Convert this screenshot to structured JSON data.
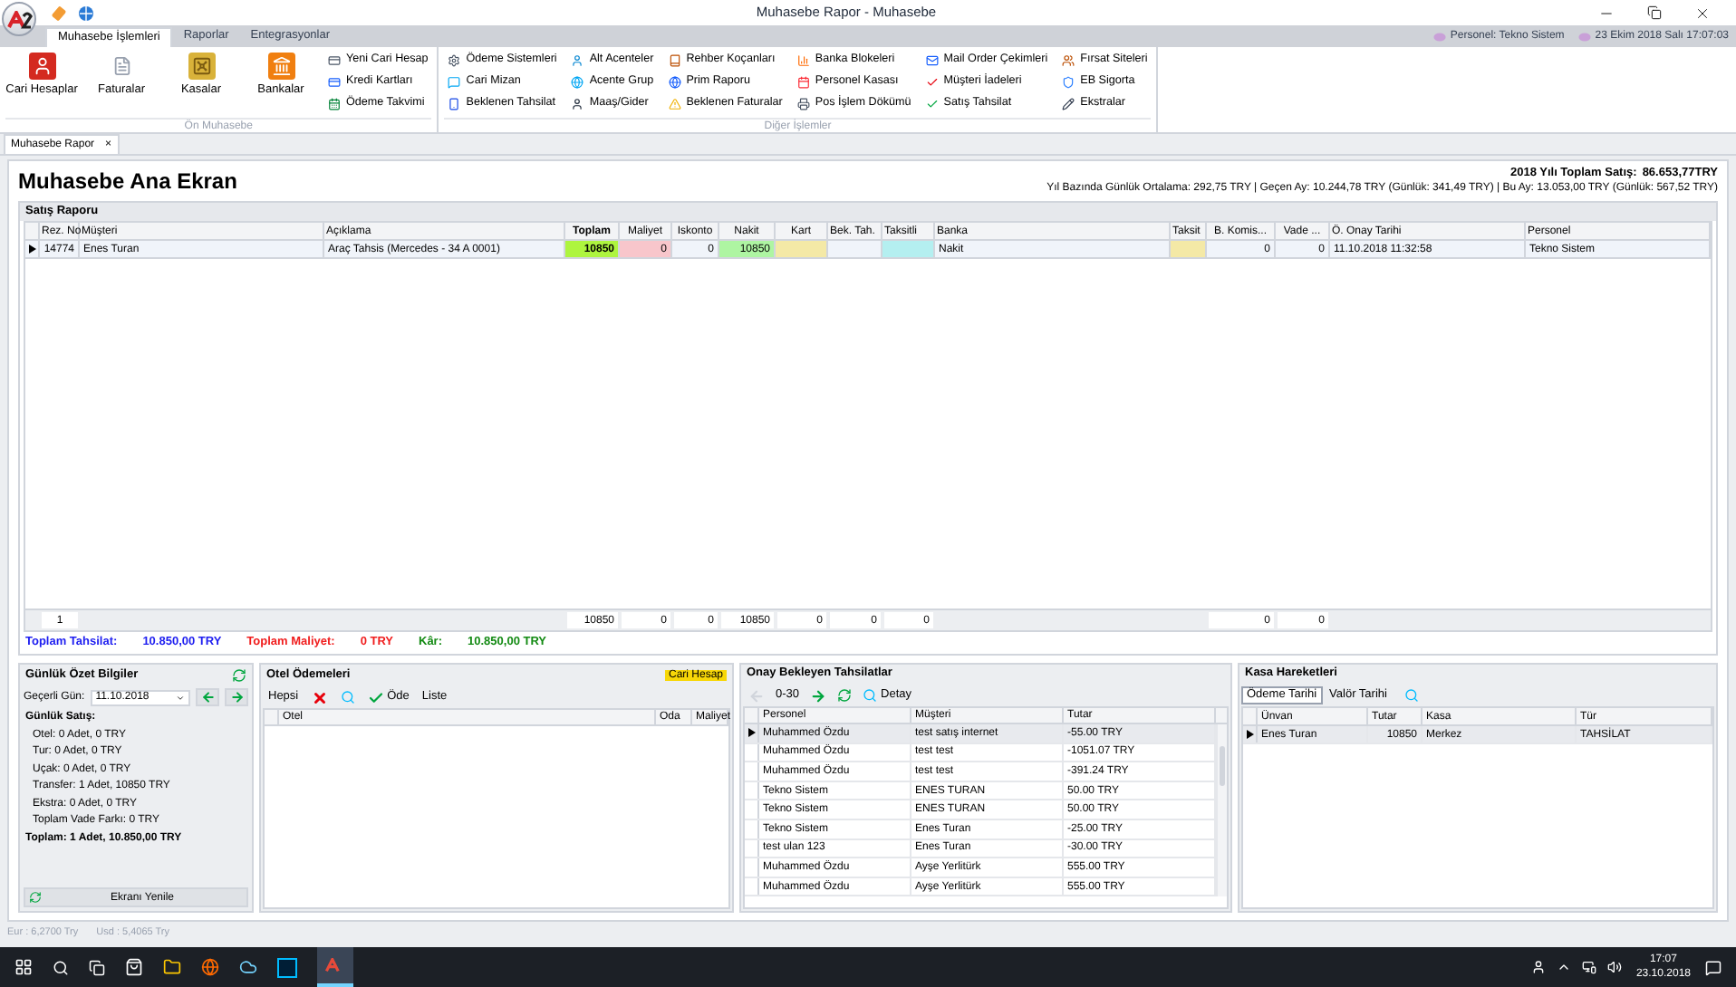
{
  "window": {
    "title": "Muhasebe Rapor - Muhasebe"
  },
  "ribbon_tabs": [
    {
      "label": "Muhasebe İşlemleri",
      "selected": true
    },
    {
      "label": "Raporlar",
      "selected": false
    },
    {
      "label": "Entegrasyonlar",
      "selected": false
    }
  ],
  "session": {
    "personel": "Personel: Tekno Sistem",
    "datetime": "23 Ekim 2018 Salı 17:07:03"
  },
  "ribbon_groups": [
    {
      "label": "Ön Muhasebe",
      "large": [
        "Cari Hesaplar",
        "Faturalar",
        "Kasalar",
        "Bankalar"
      ],
      "small": [
        [
          "Yeni Cari Hesap",
          "Kredi Kartları",
          "Ödeme Takvimi"
        ]
      ]
    },
    {
      "label": "Diğer İşlemler",
      "small": [
        [
          "Ödeme Sistemleri",
          "Cari Mizan",
          "Beklenen Tahsilat"
        ],
        [
          "Alt Acenteler",
          "Acente Grup",
          "Maaş/Gider"
        ],
        [
          "Rehber Koçanları",
          "Prim Raporu",
          "Beklenen Faturalar"
        ],
        [
          "Banka Blokeleri",
          "Personel Kasası",
          "Pos İşlem Dökümü"
        ],
        [
          "Mail Order Çekimleri",
          "Müşteri İadeleri",
          "Satış Tahsilat"
        ],
        [
          "Fırsat Siteleri",
          "EB Sigorta",
          "Ekstralar"
        ]
      ]
    }
  ],
  "document_tab": {
    "label": "Muhasebe Rapor",
    "close": "×"
  },
  "header": {
    "title": "Muhasebe Ana Ekran",
    "year_label": "2018 Yılı Toplam Satış:",
    "year_value": "86.653,77TRY",
    "summary": "Yıl Bazında Günlük Ortalama: 292,75 TRY | Geçen Ay: 10.244,78 TRY (Günlük: 341,49 TRY) | Bu Ay: 13.053,00 TRY (Günlük: 567,52 TRY)"
  },
  "sales": {
    "title": "Satış Raporu",
    "columns": {
      "rez_no": {
        "label": "Rez. No"
      },
      "musteri": {
        "label": "Müşteri"
      },
      "aciklama": {
        "label": "Açıklama"
      },
      "toplam": {
        "label": "Toplam",
        "color": "#aef53f"
      },
      "maliyet": {
        "label": "Maliyet",
        "color": "#f8c6cb"
      },
      "iskonto": {
        "label": "Iskonto"
      },
      "nakit": {
        "label": "Nakit",
        "color": "#aef5a2"
      },
      "kart": {
        "label": "Kart",
        "color": "#f4e9a6"
      },
      "bek_tah": {
        "label": "Bek. Tah."
      },
      "taksitli": {
        "label": "Taksitli",
        "color": "#b4eff0"
      },
      "banka": {
        "label": "Banka"
      },
      "taksit": {
        "label": "Taksit",
        "color": "#f4e9a6"
      },
      "b_komis": {
        "label": "B. Komis..."
      },
      "vade": {
        "label": "Vade ..."
      },
      "onay_tarihi": {
        "label": "Ö. Onay Tarihi"
      },
      "personel": {
        "label": "Personel"
      }
    },
    "rows": [
      {
        "selected": true,
        "rez_no": "14774",
        "musteri": "Enes Turan",
        "aciklama": "Araç Tahsis (Mercedes - 34 A 0001)",
        "toplam": "10850",
        "maliyet": "0",
        "iskonto": "0",
        "nakit": "10850",
        "banka": "Nakit",
        "b_komis": "0",
        "vade": "0",
        "onay_tarihi": "11.10.2018 11:32:58",
        "personel": "Tekno Sistem"
      }
    ],
    "footer": {
      "rez_no": "1",
      "toplam": "10850",
      "maliyet": "0",
      "iskonto": "0",
      "nakit": "10850",
      "kart": "0",
      "bek_tah": "0",
      "taksitli": "0",
      "b_komis": "0",
      "vade": "0"
    }
  },
  "totals": [
    {
      "label": "Toplam Tahsilat:",
      "value": "10.850,00 TRY",
      "color": "#1d1df0"
    },
    {
      "label": "Toplam Maliyet:",
      "value": "0 TRY",
      "color": "#f01d1d"
    },
    {
      "label": "Kâr:",
      "value": "10.850,00 TRY",
      "color": "#138a13"
    }
  ],
  "daily": {
    "title": "Günlük Özet Bilgiler",
    "date_label": "Geçerli Gün:",
    "date_value": "11.10.2018",
    "sales_label": "Günlük Satış:",
    "lines": [
      "Otel: 0 Adet, 0 TRY",
      "Tur: 0 Adet, 0 TRY",
      "Uçak: 0 Adet, 0 TRY",
      "Transfer: 1 Adet, 10850 TRY",
      "Ekstra: 0 Adet, 0 TRY",
      "Toplam Vade Farkı: 0 TRY"
    ],
    "total": "Toplam: 1 Adet, 10.850,00 TRY",
    "refresh": "Ekranı Yenile"
  },
  "hotel": {
    "title": "Otel Ödemeleri",
    "badge": "Cari Hesap",
    "all": "Hepsi",
    "pay": "Öde",
    "list": "Liste",
    "columns": [
      "Otel",
      "Oda",
      "Maliyet"
    ]
  },
  "pending": {
    "title": "Onay Bekleyen Tahsilatlar",
    "range": "0-30",
    "detail": "Detay",
    "columns": [
      "Personel",
      "Müşteri",
      "Tutar"
    ],
    "rows": [
      {
        "selected": true,
        "cells": [
          "Muhammed Özdu",
          "test satış internet",
          "-55.00 TRY"
        ]
      },
      {
        "selected": false,
        "cells": [
          "Muhammed Özdu",
          "test test",
          "-1051.07 TRY"
        ]
      },
      {
        "selected": false,
        "cells": [
          "Muhammed Özdu",
          "test test",
          "-391.24 TRY"
        ]
      },
      {
        "selected": false,
        "cells": [
          "Tekno Sistem",
          "ENES TURAN",
          "50.00 TRY"
        ]
      },
      {
        "selected": false,
        "cells": [
          "Tekno Sistem",
          "ENES TURAN",
          "50.00 TRY"
        ]
      },
      {
        "selected": false,
        "cells": [
          "Tekno Sistem",
          "Enes Turan",
          "-25.00 TRY"
        ]
      },
      {
        "selected": false,
        "cells": [
          "test ulan 123",
          "Enes Turan",
          "-30.00 TRY"
        ]
      },
      {
        "selected": false,
        "cells": [
          "Muhammed Özdu",
          "Ayşe Yerlitürk",
          "555.00 TRY"
        ]
      },
      {
        "selected": false,
        "cells": [
          "Muhammed Özdu",
          "Ayşe Yerlitürk",
          "555.00 TRY"
        ]
      }
    ]
  },
  "cash": {
    "title": "Kasa Hareketleri",
    "tabs": [
      {
        "label": "Ödeme Tarihi",
        "selected": true
      },
      {
        "label": "Valör Tarihi",
        "selected": false
      }
    ],
    "columns": [
      "Ünvan",
      "Tutar",
      "Kasa",
      "Tür"
    ],
    "rows": [
      {
        "selected": true,
        "cells": [
          "Enes Turan",
          "10850",
          "Merkez",
          "TAHSİLAT"
        ]
      }
    ]
  },
  "status_bar": [
    "Eur : 6,2700 Try",
    "Usd : 5,4065 Try"
  ],
  "taskbar": {
    "time": "17:07",
    "date": "23.10.2018"
  }
}
